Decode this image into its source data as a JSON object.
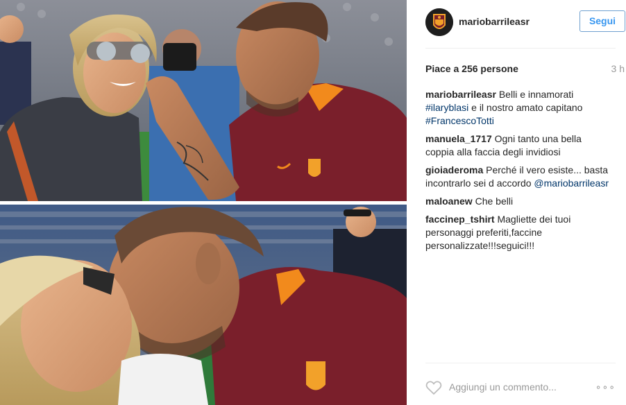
{
  "post": {
    "author": "mariobarrileasr",
    "follow_label": "Segui",
    "likes_text": "Piace a 256 persone",
    "time_text": "3 h"
  },
  "comments": [
    {
      "user": "mariobarrileasr",
      "text_1": " Belli e innamorati",
      "tag_1": "#ilaryblasi",
      "text_2": " e il nostro amato capitano",
      "tag_2": "#FrancescoTotti"
    },
    {
      "user": "manuela_1717",
      "text": " Ogni tanto una bella coppia alla faccia degli invidiosi"
    },
    {
      "user": "gioiaderoma",
      "text": " Perché il vero esiste... basta incontrarlo sei d accordo ",
      "mention": "@mariobarrileasr"
    },
    {
      "user": "maloanew",
      "text": " Che belli"
    },
    {
      "user": "faccinep_tshirt",
      "text": " Magliette dei tuoi personaggi preferiti,faccine personalizzate!!!seguici!!!"
    }
  ],
  "footer": {
    "placeholder": "Aggiungi un commento...",
    "more": "∘∘∘"
  },
  "icons": {
    "avatar": "as-roma-crest",
    "like": "heart-outline-icon",
    "options": "ellipsis-icon"
  },
  "colors": {
    "link": "#003569",
    "button_text": "#3897f0",
    "jersey": "#7a1f2b",
    "jersey_trim": "#f28a1c"
  }
}
